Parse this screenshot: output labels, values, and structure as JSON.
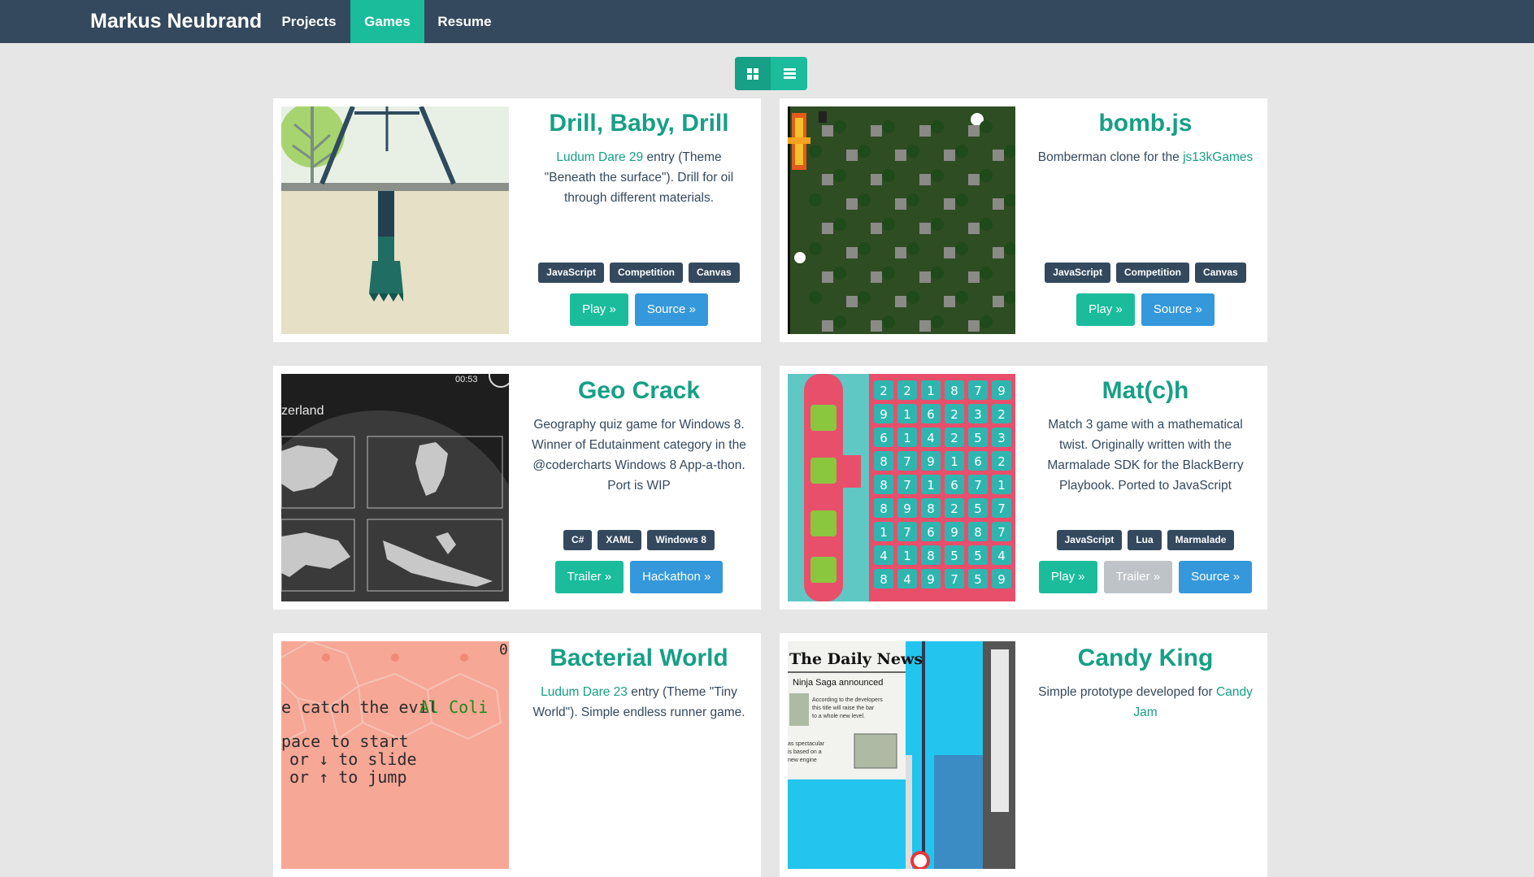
{
  "nav": {
    "brand": "Markus Neubrand",
    "items": [
      {
        "label": "Projects",
        "active": false
      },
      {
        "label": "Games",
        "active": true
      },
      {
        "label": "Resume",
        "active": false
      }
    ]
  },
  "view_toggle": {
    "grid_icon": "grid-icon",
    "list_icon": "list-icon"
  },
  "colors": {
    "navbar": "#34495e",
    "accent": "#1abc9c",
    "accent_dark": "#16a085",
    "blue": "#3498db",
    "gray": "#bdc3c7",
    "tag": "#34495e"
  },
  "games": [
    {
      "title": "Drill, Baby, Drill",
      "desc_link": "Ludum Dare 29",
      "desc_text": " entry (Theme \"Beneath the surface\"). Drill for oil through different materials.",
      "tags": [
        "JavaScript",
        "Competition",
        "Canvas"
      ],
      "buttons": [
        {
          "label": "Play »",
          "style": "green"
        },
        {
          "label": "Source »",
          "style": "blue"
        }
      ]
    },
    {
      "title": "bomb.js",
      "desc_text": "Bomberman clone for the ",
      "desc_link": "js13kGames",
      "tags": [
        "JavaScript",
        "Competition",
        "Canvas"
      ],
      "buttons": [
        {
          "label": "Play »",
          "style": "green"
        },
        {
          "label": "Source »",
          "style": "blue"
        }
      ]
    },
    {
      "title": "Geo Crack",
      "desc_text": "Geography quiz game for Windows 8. Winner of Edutainment category in the @codercharts Windows 8 App-a-thon. Port is WIP",
      "thumb_country": "zerland",
      "thumb_time": "00:53",
      "tags": [
        "C#",
        "XAML",
        "Windows 8"
      ],
      "buttons": [
        {
          "label": "Trailer »",
          "style": "green"
        },
        {
          "label": "Hackathon »",
          "style": "blue"
        }
      ]
    },
    {
      "title": "Mat(c)h",
      "desc_text": "Match 3 game with a mathematical twist. Originally written with the Marmalade SDK for the BlackBerry Playbook. Ported to JavaScript",
      "tags": [
        "JavaScript",
        "Lua",
        "Marmalade"
      ],
      "buttons": [
        {
          "label": "Play »",
          "style": "green"
        },
        {
          "label": "Trailer »",
          "style": "gray"
        },
        {
          "label": "Source »",
          "style": "blue"
        }
      ]
    },
    {
      "title": "Bacterial World",
      "desc_link": "Ludum Dare 23",
      "desc_text": " entry (Theme \"Tiny World\"). Simple endless runner game.",
      "thumb_lines": [
        "e catch the evil ",
        "Al Coli",
        "pace to start",
        "or ↓ to slide",
        "or ↑ to jump"
      ]
    },
    {
      "title": "Candy King",
      "desc_text": "Simple prototype developed for ",
      "desc_link": "Candy Jam",
      "thumb_paper": "The Daily News",
      "thumb_headline": "Ninja Saga announced",
      "thumb_body": "According to the developers this title will raise the bar to a whole new level.",
      "thumb_body2": "as spectacular is based on a new engine"
    }
  ]
}
